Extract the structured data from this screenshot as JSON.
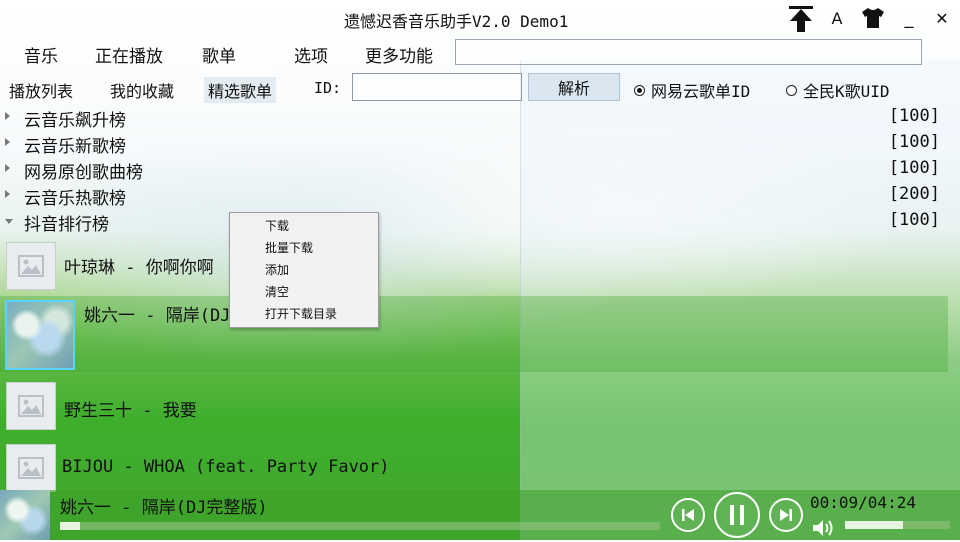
{
  "window": {
    "title": "遗憾迟香音乐助手V2.0 Demo1",
    "controls": {
      "font_button": "A",
      "minimize": "_",
      "close": "✕"
    }
  },
  "menu": {
    "items": [
      "音乐",
      "正在播放",
      "歌单",
      "选项",
      "更多功能"
    ],
    "active_index": 2,
    "search_value": ""
  },
  "subnav": {
    "items": [
      "播放列表",
      "我的收藏",
      "精选歌单"
    ],
    "active_index": 2,
    "id_label": "ID:",
    "id_value": "",
    "parse_button": "解析",
    "radio_options": [
      {
        "label": "网易云歌单ID",
        "checked": true
      },
      {
        "label": "全民K歌UID",
        "checked": false
      }
    ]
  },
  "playlists": [
    {
      "name": "云音乐飙升榜",
      "count": "[100]",
      "expanded": false
    },
    {
      "name": "云音乐新歌榜",
      "count": "[100]",
      "expanded": false
    },
    {
      "name": "网易原创歌曲榜",
      "count": "[100]",
      "expanded": false
    },
    {
      "name": "云音乐热歌榜",
      "count": "[200]",
      "expanded": false
    },
    {
      "name": "抖音排行榜",
      "count": "[100]",
      "expanded": true
    }
  ],
  "songs": [
    {
      "title": "叶琼琳 - 你啊你啊",
      "has_art": false,
      "selected": false
    },
    {
      "title": "姚六一 - 隔岸(DJ完整版)",
      "has_art": true,
      "selected": true
    },
    {
      "title": "野生三十 - 我要",
      "has_art": false,
      "selected": false
    },
    {
      "title": "BIJOU - WHOA (feat. Party Favor)",
      "has_art": false,
      "selected": false
    }
  ],
  "context_menu": {
    "items": [
      "下载",
      "批量下载",
      "添加",
      "清空",
      "打开下载目录"
    ]
  },
  "player": {
    "now_playing": "姚六一 - 隔岸(DJ完整版)",
    "time": "00:09/04:24",
    "progress_fraction": 0.034,
    "volume_fraction": 0.55
  },
  "colors": {
    "accent_green": "#3fae2d",
    "selected_row": "#46aa37",
    "art_border": "#5cd3ff"
  }
}
